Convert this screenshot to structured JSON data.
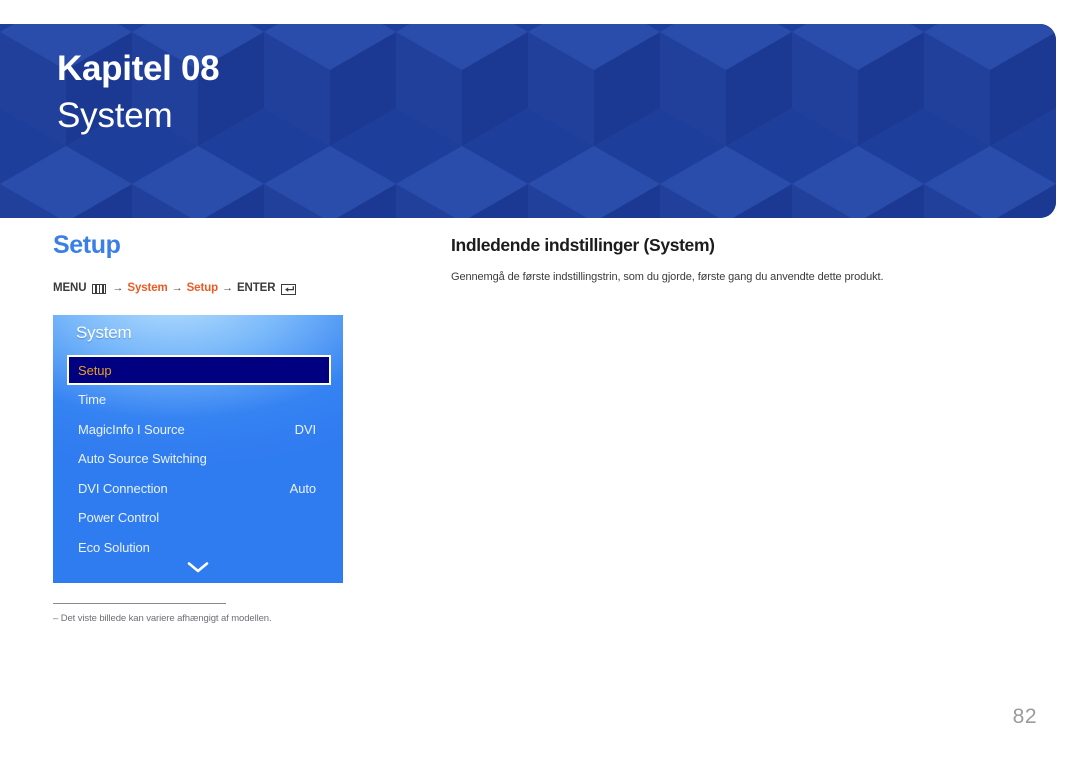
{
  "header": {
    "chapter_label": "Kapitel 08",
    "chapter_title": "System",
    "background_color": "#1e3e9c"
  },
  "left": {
    "section_title": "Setup",
    "section_title_color": "#3a7fe8",
    "breadcrumb": {
      "menu_label": "MENU",
      "menu_icon": "menu-bars-icon",
      "arrow": "→",
      "step_system": "System",
      "step_setup": "Setup",
      "enter_label": "ENTER",
      "enter_icon": "enter-return-icon",
      "accent_color": "#ef5a24"
    },
    "footnote": {
      "dash": "–",
      "text": "Det viste billede kan variere afhængigt af modellen."
    }
  },
  "osd": {
    "title": "System",
    "selected_index": 0,
    "scroll_icon": "chevron-down-icon",
    "selected_bg_color": "#000080",
    "selected_text_color": "#e8a020",
    "panel_color": "#2f7bf0",
    "items": [
      {
        "label": "Setup",
        "value": ""
      },
      {
        "label": "Time",
        "value": ""
      },
      {
        "label": "MagicInfo I Source",
        "value": "DVI"
      },
      {
        "label": "Auto Source Switching",
        "value": ""
      },
      {
        "label": "DVI Connection",
        "value": "Auto"
      },
      {
        "label": "Power Control",
        "value": ""
      },
      {
        "label": "Eco Solution",
        "value": ""
      }
    ]
  },
  "right": {
    "heading": "Indledende indstillinger (System)",
    "body": "Gennemgå de første indstillingstrin, som du gjorde, første gang du anvendte dette produkt."
  },
  "page_number": "82"
}
